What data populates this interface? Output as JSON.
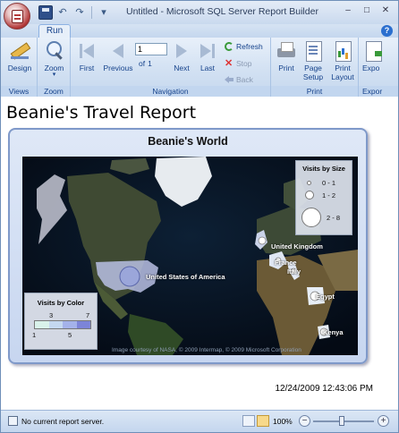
{
  "window": {
    "title": "Untitled - Microsoft SQL Server Report Builder"
  },
  "quick_access": {
    "icons": [
      "save-icon",
      "undo-icon",
      "redo-icon"
    ]
  },
  "ribbon": {
    "active_tab": "Run",
    "groups": {
      "views": {
        "label": "Views",
        "design": "Design"
      },
      "zoom": {
        "label": "Zoom",
        "zoom": "Zoom"
      },
      "navigation": {
        "label": "Navigation",
        "first": "First",
        "previous": "Previous",
        "page_value": "1",
        "of_text": "of",
        "total_pages": "1",
        "next": "Next",
        "last": "Last",
        "refresh": "Refresh",
        "stop": "Stop",
        "back": "Back"
      },
      "print": {
        "label": "Print",
        "print": "Print",
        "page_setup_1": "Page",
        "page_setup_2": "Setup",
        "print_layout_1": "Print",
        "print_layout_2": "Layout"
      },
      "export": {
        "label": "Expor",
        "export": "Expo"
      }
    }
  },
  "report": {
    "title": "Beanie's Travel Report",
    "map": {
      "title": "Beanie's World",
      "copyright": "Image courtesy of NASA, © 2009 Intermap, © 2009 Microsoft Corporation",
      "countries": [
        "United Kingdom",
        "France",
        "Italy",
        "United States of America",
        "Egypt",
        "Kenya"
      ],
      "size_legend": {
        "title": "Visits by Size",
        "items": [
          "0 - 1",
          "1 - 2",
          "2 - 8"
        ]
      },
      "color_legend": {
        "title": "Visits by Color",
        "top_ticks": [
          "3",
          "7"
        ],
        "bottom_ticks": [
          "1",
          "5"
        ],
        "colors": [
          "#d9f2ea",
          "#c4d8f0",
          "#a4b2ea",
          "#7c84d8"
        ]
      }
    },
    "timestamp": "12/24/2009 12:43:06 PM"
  },
  "statusbar": {
    "text": "No current report server.",
    "zoom": "100%"
  }
}
